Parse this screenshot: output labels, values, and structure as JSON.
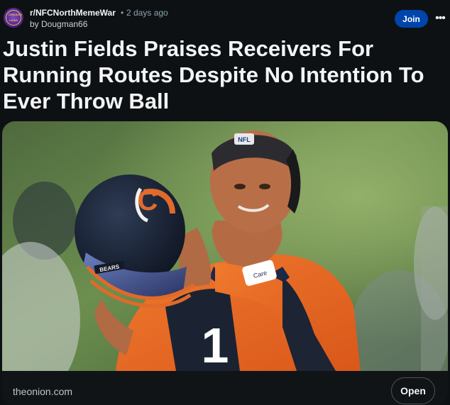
{
  "post": {
    "subreddit": "r/NFCNorthMemeWar",
    "separator": "•",
    "age": "2 days ago",
    "author": "by Dougman66",
    "join_label": "Join",
    "more_label": "•••",
    "title": "Justin Fields Praises Receivers For Running Routes Despite No Intention To Ever Throw Ball"
  },
  "avatar": {
    "top_text": "CHICAGO",
    "bottom_text": "LIONS"
  },
  "link_card": {
    "domain": "theonion.com",
    "open_label": "Open",
    "image_helmet_logo": "C",
    "image_helmet_text": "BEARS",
    "image_headband_text": "NFL",
    "image_jersey_number": "1",
    "image_badge_text": "Care"
  },
  "colors": {
    "background": "#0e1113",
    "join_button": "#0045ac",
    "jersey_orange": "#e96a23",
    "helmet_navy": "#1b2535"
  }
}
